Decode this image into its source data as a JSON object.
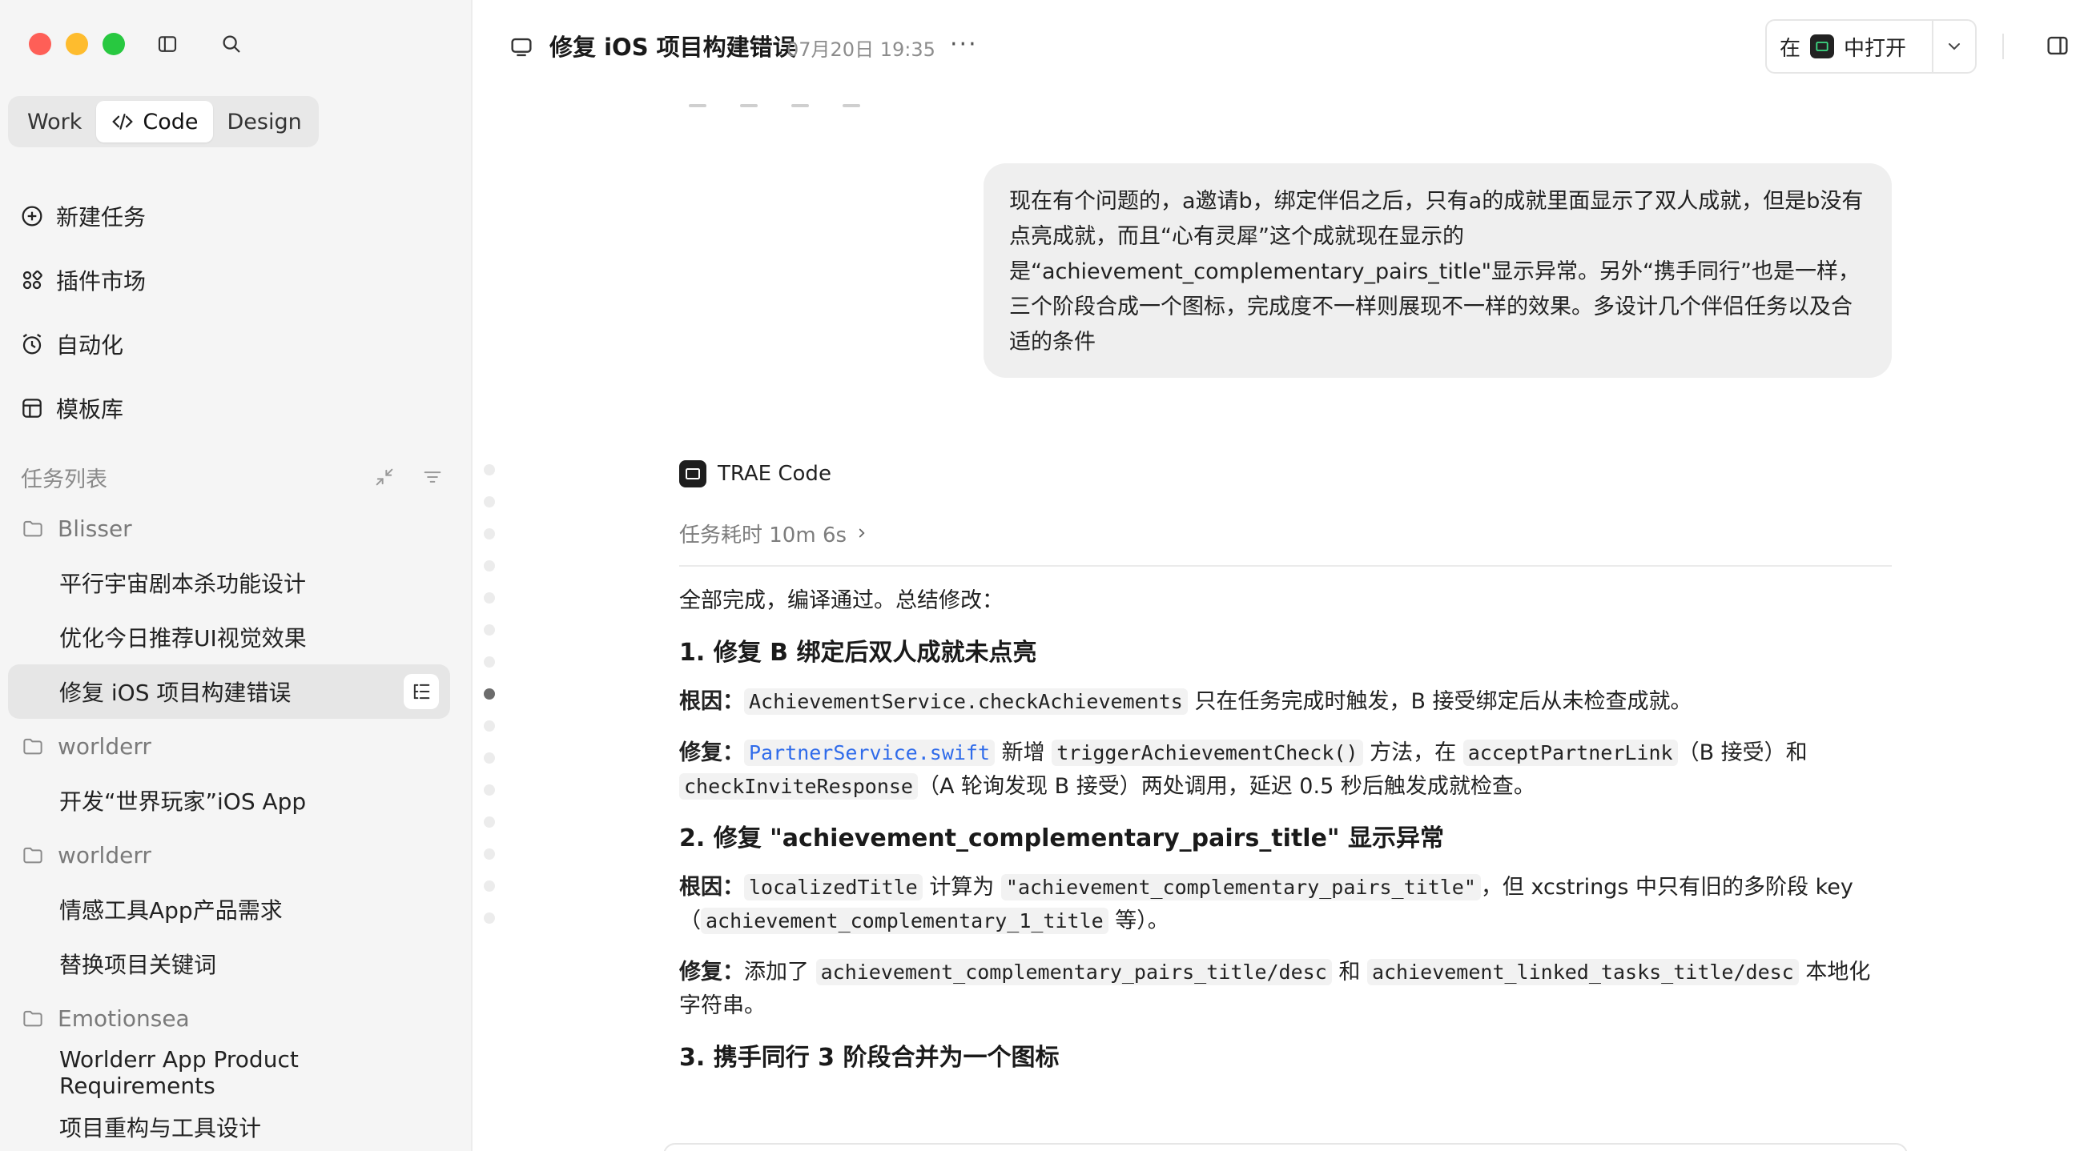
{
  "sidebar": {
    "modes": [
      {
        "label": "Work"
      },
      {
        "label": "Code"
      },
      {
        "label": "Design"
      }
    ],
    "nav": [
      {
        "label": "新建任务",
        "icon": "plus-circle-icon"
      },
      {
        "label": "插件市场",
        "icon": "plugins-icon"
      },
      {
        "label": "自动化",
        "icon": "alarm-icon"
      },
      {
        "label": "模板库",
        "icon": "template-icon"
      }
    ],
    "tasks_header": "任务列表",
    "groups": [
      {
        "folder": "Blisser",
        "tasks": [
          "平行宇宙剧本杀功能设计",
          "优化今日推荐UI视觉效果",
          "修复 iOS 项目构建错误"
        ]
      },
      {
        "folder": "worlderr",
        "tasks": [
          "开发“世界玩家”iOS App"
        ]
      },
      {
        "folder": "worlderr",
        "tasks": [
          "情感工具App产品需求",
          "替换项目关键词"
        ]
      },
      {
        "folder": "Emotionsea",
        "tasks": [
          "Worlderr App Product Requirements",
          "项目重构与工具设计"
        ]
      }
    ],
    "active_task": "修复 iOS 项目构建错误"
  },
  "header": {
    "title": "修复 iOS 项目构建错误",
    "date": "07月20日 19:35",
    "more": "···",
    "open_in_prefix": "在",
    "open_in_suffix": "中打开"
  },
  "user_message": "现在有个问题的，a邀请b，绑定伴侣之后，只有a的成就里面显示了双人成就，但是b没有点亮成就，而且“心有灵犀”这个成就现在显示的是“achievement_complementary_pairs_title\"显示异常。另外“携手同行”也是一样，三个阶段合成一个图标，完成度不一样则展现不一样的效果。多设计几个伴侣任务以及合适的条件",
  "assistant": {
    "name": "TRAE Code",
    "duration": "任务耗时 10m 6s",
    "intro": "全部完成，编译通过。总结修改：",
    "s1": {
      "title": "1. 修复 B 绑定后双人成就未点亮",
      "cause_label": "根因：",
      "cause_code": "AchievementService.checkAchievements",
      "cause_text": "只在任务完成时触发，B 接受绑定后从未检查成就。",
      "fix_label": "修复：",
      "fix_file": "PartnerService.swift",
      "fix_t1": "新增",
      "fix_code1": "triggerAchievementCheck()",
      "fix_t2": "方法，在",
      "fix_code2": "acceptPartnerLink",
      "fix_t3": "（B 接受）和",
      "fix_code3": "checkInviteResponse",
      "fix_t4": "（A 轮询发现 B 接受）两处调用，延迟 0.5 秒后触发成就检查。"
    },
    "s2": {
      "title": "2. 修复 \"achievement_complementary_pairs_title\" 显示异常",
      "cause_label": "根因：",
      "cause_code1": "localizedTitle",
      "cause_t1": "计算为",
      "cause_code2": "\"achievement_complementary_pairs_title\"",
      "cause_t2": "，但 xcstrings 中只有旧的多阶段 key（",
      "cause_code3": "achievement_complementary_1_title",
      "cause_t3": "等）。",
      "fix_label": "修复：",
      "fix_t1": "添加了",
      "fix_code1": "achievement_complementary_pairs_title/desc",
      "fix_t2": "和",
      "fix_code2": "achievement_linked_tasks_title/desc",
      "fix_t3": "本地化字符串。"
    },
    "s3": {
      "title": "3. 携手同行 3 阶段合并为一个图标"
    }
  },
  "colors": {
    "sidebar_bg": "#f5f5f5",
    "link": "#2f6bea",
    "bubble": "#efefef"
  }
}
